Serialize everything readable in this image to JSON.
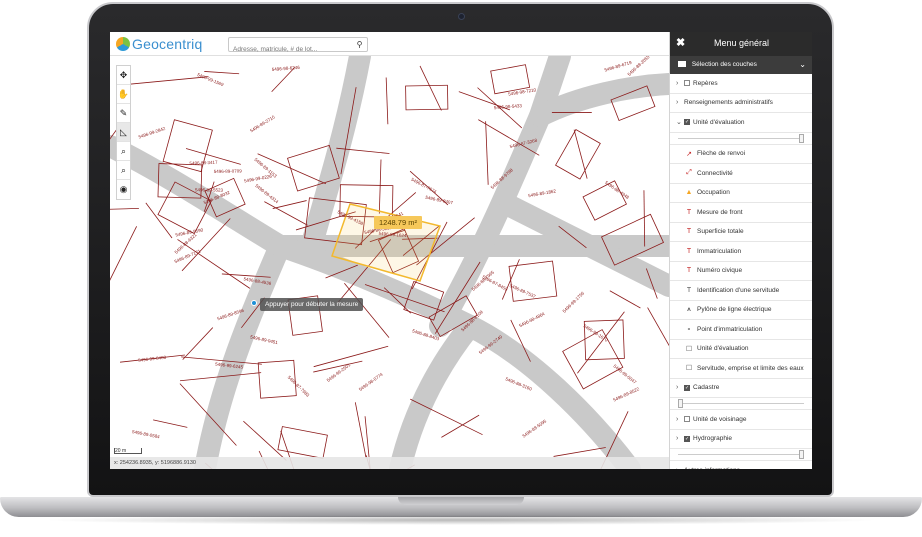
{
  "app": {
    "brand": "Geocentriq"
  },
  "search": {
    "placeholder": "Adresse, matricule, # de lot...",
    "icon": "search-icon"
  },
  "map": {
    "tools": [
      {
        "name": "pan-arrows-icon",
        "glyph": "✥",
        "active": false
      },
      {
        "name": "hand-icon",
        "glyph": "✋",
        "active": false
      },
      {
        "name": "ruler-icon",
        "glyph": "✎",
        "active": false
      },
      {
        "name": "area-measure-icon",
        "glyph": "◺",
        "active": true
      },
      {
        "name": "zoom-in-icon",
        "glyph": "⌕",
        "active": false
      },
      {
        "name": "zoom-out-icon",
        "glyph": "⌕",
        "active": false
      },
      {
        "name": "locate-icon",
        "glyph": "◉",
        "active": false
      }
    ],
    "area_label": "1248.79 m²",
    "measure_tooltip": "Appuyer pour débuter la mesure",
    "scale": "20 m",
    "coordinates": "x: 254236.8935, y: 5196886.9130",
    "lot_labels": [
      "5496-98-0774",
      "5496-98-3641",
      "5496-98-4864",
      "5496-98-5433",
      "5496-98-7210",
      "5496-98-6246",
      "5496-88-9798",
      "5496-99-1624",
      "5496-99-0408",
      "5496-99-2740",
      "5496-99-5047",
      "5496-99-0226",
      "5496-99-1670",
      "5496-99-4158",
      "5496-99-6245",
      "5496-89-8407",
      "5496-89-9590",
      "5496-89-7171",
      "5496-89-0584",
      "5496-89-1153",
      "5496-89-0451",
      "5496-99-2501",
      "5496-99-1569",
      "5496-99-1756",
      "5496-99-2842",
      "5496-88-2055",
      "5496-88-4536",
      "5496-88-3417",
      "5496-88-6321",
      "5496-88-8403",
      "5496-88-4948",
      "5496-88-8109",
      "5496-89-5523",
      "5496-89-7537",
      "5496-89-8522",
      "5496-89-8596",
      "5496-89-1862",
      "5496-89-4314",
      "5496-89-6719",
      "5496-87-7983",
      "5496-87-3268",
      "5496-87-8459",
      "5496-87-7674",
      "5496-88-3160",
      "5496-88-7965",
      "5496-88-5095",
      "5496-88-5052",
      "5496-88-8032",
      "5496-89-2710",
      "5496-89-0709"
    ]
  },
  "panel": {
    "title": "Menu général",
    "section": "Sélection des couches",
    "layers": [
      {
        "label": "Repères",
        "checked": false,
        "arrow": "›",
        "kind": "group"
      },
      {
        "label": "Renseignements administratifs",
        "checked": null,
        "arrow": "›",
        "kind": "group"
      },
      {
        "label": "Unité d'évaluation",
        "checked": true,
        "arrow": "⌄",
        "kind": "group",
        "slider": 1.0
      },
      {
        "label": "Flèche de renvoi",
        "symbol": "↗",
        "color": "#c62828",
        "kind": "legend"
      },
      {
        "label": "Connectivité",
        "symbol": "⤢",
        "color": "#c62828",
        "kind": "legend"
      },
      {
        "label": "Occupation",
        "symbol": "▲",
        "color": "#f5a623",
        "kind": "legend"
      },
      {
        "label": "Mesure de front",
        "symbol": "T",
        "color": "#c62828",
        "kind": "legend"
      },
      {
        "label": "Superficie totale",
        "symbol": "T",
        "color": "#c62828",
        "kind": "legend"
      },
      {
        "label": "Immatriculation",
        "symbol": "T",
        "color": "#c62828",
        "kind": "legend"
      },
      {
        "label": "Numéro civique",
        "symbol": "T",
        "color": "#c62828",
        "kind": "legend"
      },
      {
        "label": "Identification d'une servitude",
        "symbol": "T",
        "color": "#555555",
        "kind": "legend"
      },
      {
        "label": "Pylône de ligne électrique",
        "symbol": "⩚",
        "color": "#333333",
        "kind": "legend"
      },
      {
        "label": "Point d'immatriculation",
        "symbol": "∘",
        "color": "#555555",
        "kind": "legend"
      },
      {
        "label": "Unité d'évaluation",
        "symbol": "☐",
        "color": "#555555",
        "kind": "legend"
      },
      {
        "label": "Servitude, emprise et limite des eaux",
        "symbol": "☐",
        "color": "#555555",
        "kind": "legend"
      },
      {
        "label": "Cadastre",
        "checked": true,
        "arrow": "›",
        "kind": "group",
        "slider": 0.0
      },
      {
        "label": "Unité de voisinage",
        "checked": false,
        "arrow": "›",
        "kind": "group"
      },
      {
        "label": "Hydrographie",
        "checked": true,
        "arrow": "›",
        "kind": "group",
        "slider": 1.0
      },
      {
        "label": "Autres informations",
        "checked": null,
        "arrow": "›",
        "kind": "group"
      }
    ]
  }
}
